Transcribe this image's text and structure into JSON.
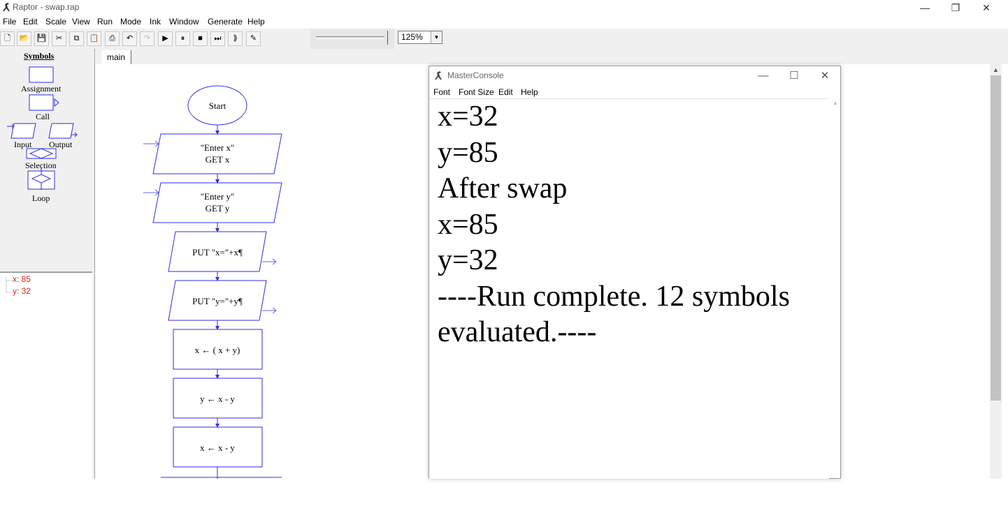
{
  "window": {
    "title": "Raptor - swap.rap"
  },
  "menu": [
    "File",
    "Edit",
    "Scale",
    "View",
    "Run",
    "Mode",
    "Ink",
    "Window",
    "Generate",
    "Help"
  ],
  "toolbar": {
    "zoom_value": "125%",
    "zoom_slider_level": 1.0,
    "buttons": [
      "new",
      "open",
      "save",
      "cut",
      "copy",
      "paste",
      "print",
      "undo",
      "redo",
      "run",
      "pause",
      "stop",
      "step",
      "clear-break",
      "pen"
    ]
  },
  "symbols_panel": {
    "title": "Symbols",
    "items": [
      {
        "label": "Assignment"
      },
      {
        "label": "Call"
      },
      {
        "label": "Input"
      },
      {
        "label": "Output"
      },
      {
        "label": "Selection"
      },
      {
        "label": "Loop"
      }
    ]
  },
  "variables": [
    {
      "text": "x: 85"
    },
    {
      "text": "y: 32"
    }
  ],
  "tabs": [
    {
      "label": "main"
    }
  ],
  "flowchart": {
    "start": "Start",
    "nodes": [
      {
        "type": "input",
        "lines": [
          "\"Enter x\"",
          "GET x"
        ]
      },
      {
        "type": "input",
        "lines": [
          "\"Enter y\"",
          "GET y"
        ]
      },
      {
        "type": "output",
        "lines": [
          "PUT \"x=\"+x¶"
        ]
      },
      {
        "type": "output",
        "lines": [
          "PUT \"y=\"+y¶"
        ]
      },
      {
        "type": "assign",
        "lines": [
          "x ← ( x + y)"
        ]
      },
      {
        "type": "assign",
        "lines": [
          "y ← x  -  y"
        ]
      },
      {
        "type": "assign",
        "lines": [
          "x ← x  -  y"
        ]
      }
    ]
  },
  "console": {
    "title": "MasterConsole",
    "menu": [
      "Font",
      "Font Size",
      "Edit",
      "Help"
    ],
    "lines": [
      "x=32",
      "y=85",
      "After swap",
      "x=85",
      "y=32",
      "----Run complete.  12 symbols",
      "evaluated.----"
    ]
  },
  "colors": {
    "flow_stroke": "#2e2ee0",
    "var_text": "#e0201a"
  }
}
